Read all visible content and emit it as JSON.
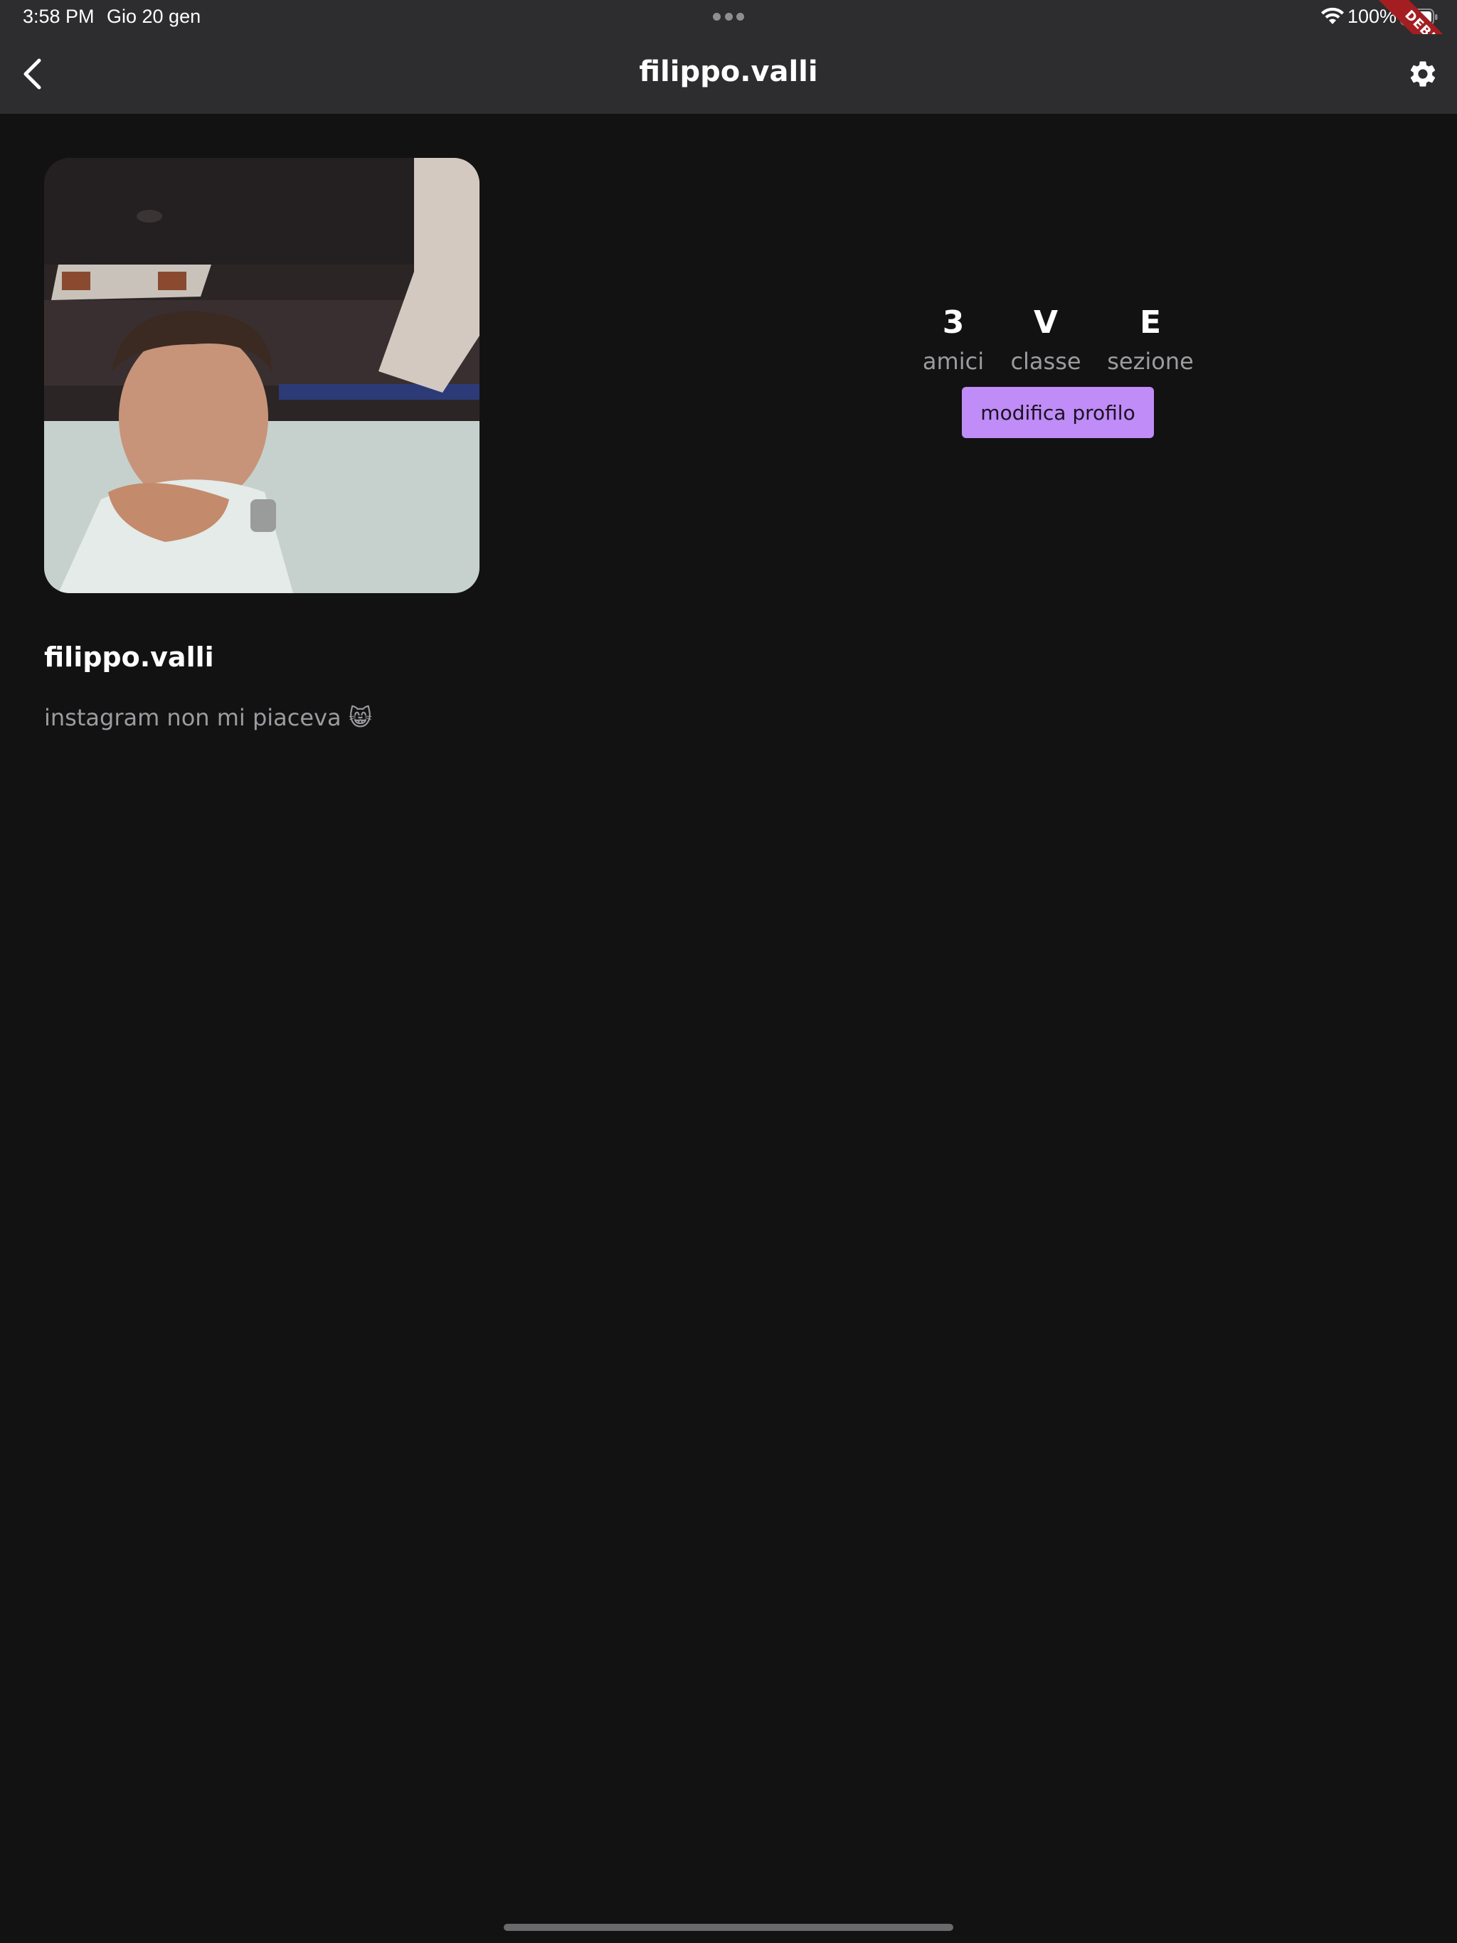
{
  "status_bar": {
    "time": "3:58 PM",
    "date": "Gio 20 gen",
    "battery_percent": "100%",
    "battery_level": 1.0
  },
  "debug_banner": "DEBUG",
  "app_bar": {
    "title": "filippo.valli",
    "back_icon": "chevron-left-icon",
    "settings_icon": "gear-icon"
  },
  "profile": {
    "username": "filippo.valli",
    "bio": "instagram non mi piaceva 😸",
    "avatar_alt": "profile photo"
  },
  "stats": {
    "amici": {
      "value": "3",
      "label": "amici"
    },
    "classe": {
      "value": "V",
      "label": "classe"
    },
    "sezione": {
      "value": "E",
      "label": "sezione"
    }
  },
  "actions": {
    "edit_profile_label": "modifica profilo"
  },
  "colors": {
    "background": "#121213",
    "app_bar": "#2d2d2f",
    "accent": "#c08cf7",
    "secondary_text": "#9c9ca0"
  }
}
